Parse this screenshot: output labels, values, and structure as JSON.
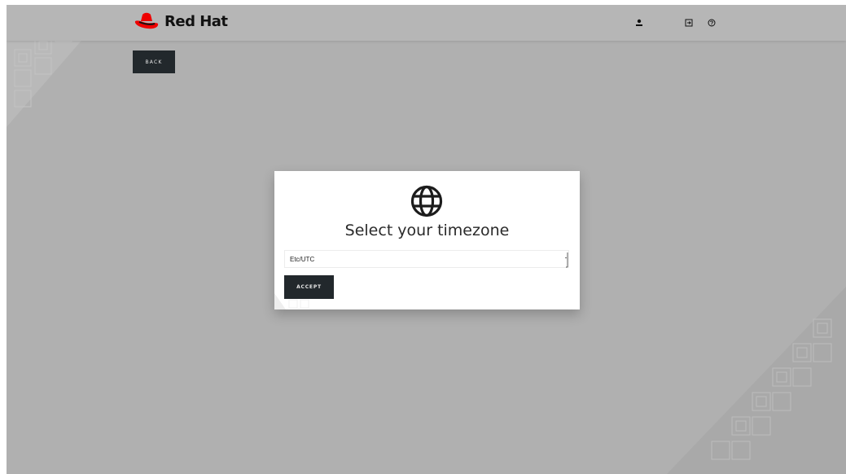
{
  "header": {
    "brand": "Red Hat",
    "icons": [
      "user-icon",
      "logout-icon",
      "help-icon"
    ]
  },
  "nav": {
    "back_label": "BACK"
  },
  "modal": {
    "icon": "globe-icon",
    "title": "Select your timezone",
    "timezone_value": "Etc/UTC",
    "accept_label": "ACCEPT"
  },
  "colors": {
    "brand_red": "#ee0000",
    "button_dark": "#22282c",
    "overlay_gray": "#b0b0b0"
  }
}
